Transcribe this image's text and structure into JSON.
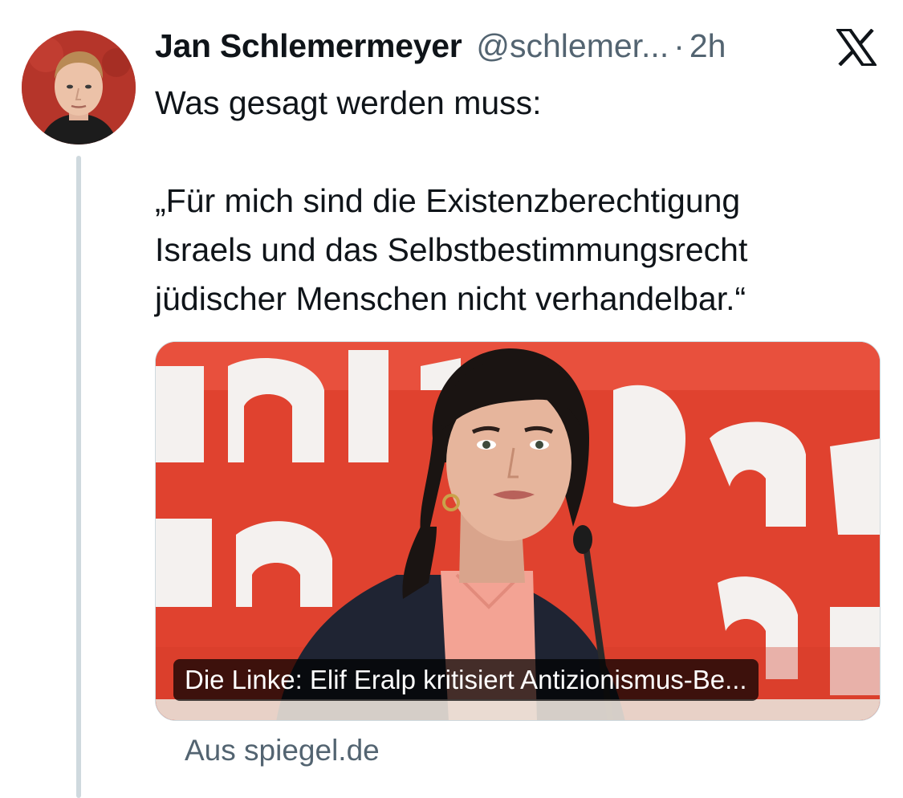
{
  "tweet": {
    "author": {
      "display_name": "Jan Schlemermeyer",
      "handle": "@schlemer...",
      "separator": "·",
      "time": "2h"
    },
    "platform_icon": "x-logo-icon",
    "text_lines": [
      "Was gesagt werden muss:",
      "„Für mich sind die Existenzberechtigung",
      "Israels und das Selbstbestimmungsrecht",
      "jüdischer Menschen nicht verhandelbar.“"
    ],
    "link_card": {
      "caption": "Die Linke: Elif Eralp kritisiert Antizionismus-Be...",
      "source": "Aus spiegel.de"
    }
  },
  "colors": {
    "text_primary": "#0f1419",
    "text_secondary": "#536471",
    "thread_line": "#cfd9de",
    "card_background_red": "#e0422f"
  }
}
